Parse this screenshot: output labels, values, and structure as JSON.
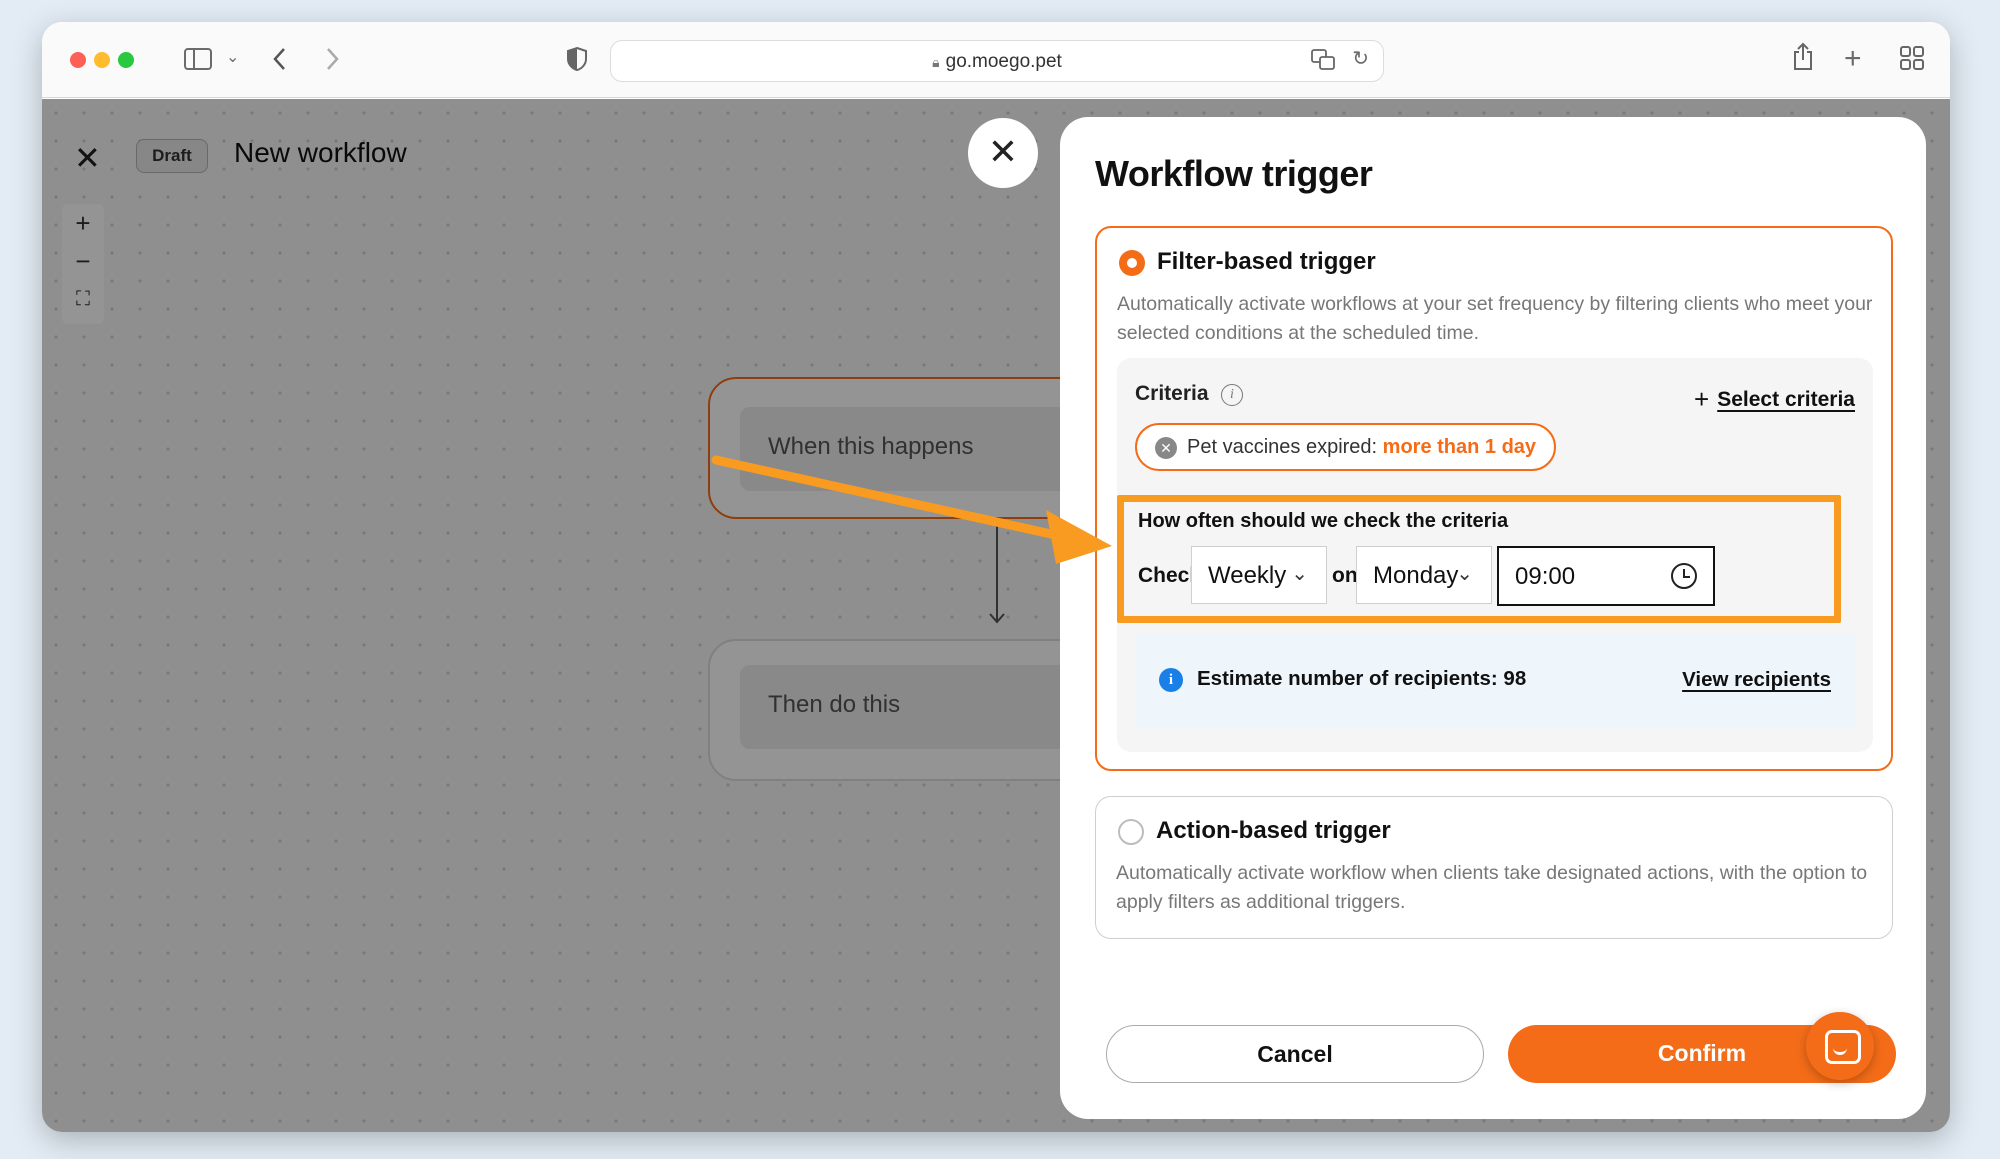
{
  "browser": {
    "url": "go.moego.pet"
  },
  "editor": {
    "status_badge": "Draft",
    "title": "New workflow",
    "zoom": {
      "in": "+",
      "out": "−",
      "fit": "⛶"
    },
    "nodes": [
      {
        "label": "When this happens"
      },
      {
        "label": "Then do this"
      }
    ]
  },
  "panel": {
    "title": "Workflow trigger",
    "filter_trigger": {
      "title": "Filter-based trigger",
      "description": "Automatically activate workflows at your set frequency by filtering clients who meet your selected conditions at the scheduled time.",
      "selected": true,
      "criteria_label": "Criteria",
      "select_criteria": "Select criteria",
      "chip": {
        "label": "Pet vaccines expired:",
        "value": "more than 1 day"
      },
      "frequency": {
        "title": "How often should we check the criteria",
        "check_label": "Check",
        "period": "Weekly",
        "on_label": "on",
        "day": "Monday",
        "time": "09:00"
      },
      "estimate": {
        "text": "Estimate number of recipients: 98",
        "link": "View recipients"
      }
    },
    "action_trigger": {
      "title": "Action-based trigger",
      "description": "Automatically activate workflow when clients take designated actions, with the option to apply filters as additional triggers.",
      "selected": false
    },
    "buttons": {
      "cancel": "Cancel",
      "confirm": "Confirm"
    }
  },
  "colors": {
    "accent": "#f46c18",
    "highlight": "#f89b20",
    "info": "#1a7fe6"
  }
}
